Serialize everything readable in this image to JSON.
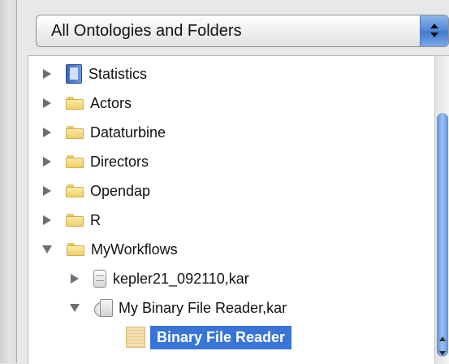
{
  "selector": {
    "label": "All Ontologies and Folders"
  },
  "tree": {
    "items": [
      {
        "label": "Statistics",
        "expanded": false,
        "icon": "book-icon"
      },
      {
        "label": "Actors",
        "expanded": false,
        "icon": "folder-icon"
      },
      {
        "label": "Dataturbine",
        "expanded": false,
        "icon": "folder-icon"
      },
      {
        "label": "Directors",
        "expanded": false,
        "icon": "folder-icon"
      },
      {
        "label": "Opendap",
        "expanded": false,
        "icon": "folder-icon"
      },
      {
        "label": "R",
        "expanded": false,
        "icon": "folder-icon"
      },
      {
        "label": "MyWorkflows",
        "expanded": true,
        "icon": "folder-icon"
      },
      {
        "label": "kepler21_092110,kar",
        "expanded": false,
        "icon": "kar-file-icon"
      },
      {
        "label": "My Binary File Reader,kar",
        "expanded": true,
        "icon": "kar-archive-icon"
      },
      {
        "label": "Binary File Reader",
        "selected": true,
        "icon": "document-icon"
      }
    ]
  },
  "colors": {
    "selection": "#3875d7",
    "scroll_thumb": "#5b92de"
  }
}
